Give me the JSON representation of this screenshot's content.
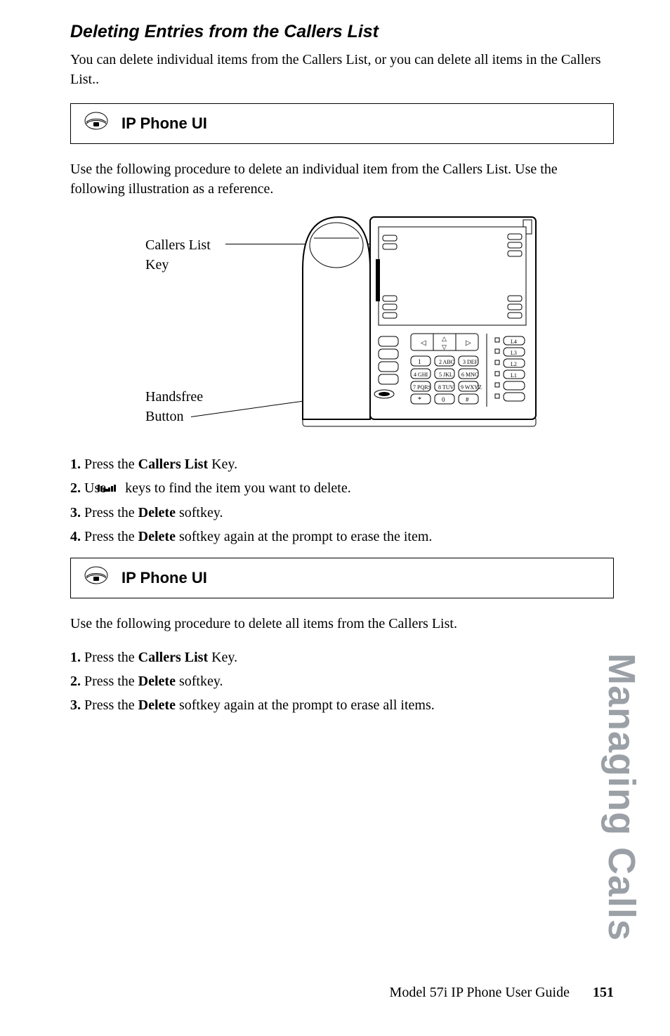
{
  "heading": "Deleting Entries from the Callers List",
  "intro": "You can delete individual items from the Callers List, or you can delete all items in the Callers List..",
  "ui_box_label": "IP Phone UI",
  "procedure1_intro": "Use the following procedure to delete an individual item from the Callers List. Use the following illustration as a reference.",
  "callouts": {
    "callers_list_key_l1": "Callers List",
    "callers_list_key_l2": "Key",
    "handsfree_l1": "Handsfree",
    "handsfree_l2": "Button"
  },
  "steps1": {
    "s1_prefix": "Press the ",
    "s1_bold": "Callers List",
    "s1_suffix": " Key.",
    "s2_prefix": "Use ",
    "s2_suffix": " keys to find the item you want to delete.",
    "s3_prefix": "Press the ",
    "s3_bold": "Delete",
    "s3_suffix": " softkey.",
    "s4_prefix": "Press the ",
    "s4_bold": "Delete",
    "s4_suffix": " softkey again at the prompt to erase the item."
  },
  "procedure2_intro": "Use the following procedure to delete all items from the Callers List.",
  "steps2": {
    "s1_prefix": "Press the ",
    "s1_bold": "Callers List",
    "s1_suffix": " Key.",
    "s2_prefix": "Press the ",
    "s2_bold": "Delete",
    "s2_suffix": " softkey.",
    "s3_prefix": "Press the ",
    "s3_bold": "Delete",
    "s3_suffix": " softkey again at the prompt to erase all items."
  },
  "side_tab": "Managing Calls",
  "footer_text": "Model 57i IP Phone User Guide",
  "footer_page": "151"
}
